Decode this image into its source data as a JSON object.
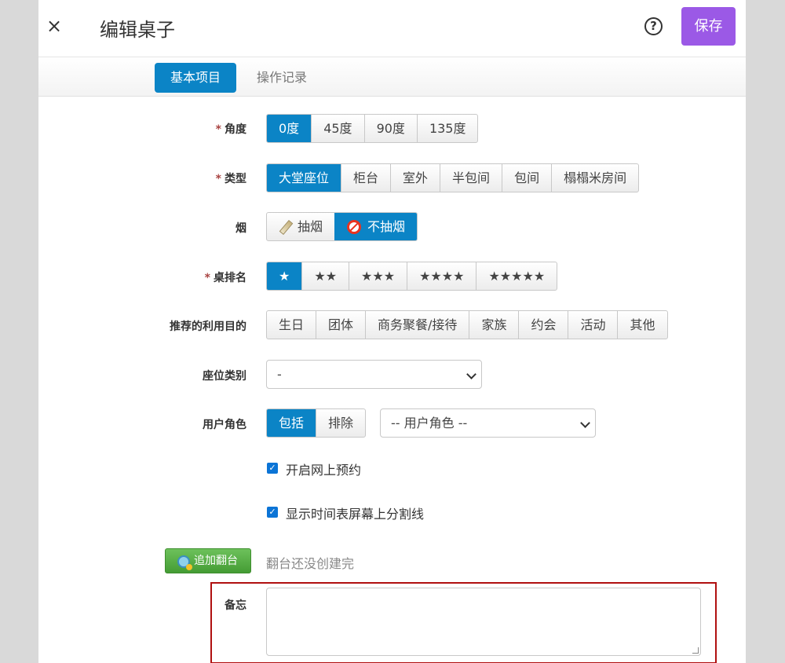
{
  "header": {
    "close_symbol": "×",
    "title": "编辑桌子",
    "help_symbol": "?",
    "save_label": "保存"
  },
  "tabs": [
    {
      "label": "基本项目",
      "active": true
    },
    {
      "label": "操作记录",
      "active": false
    }
  ],
  "required_mark": "*",
  "fields": {
    "angle": {
      "label": "角度",
      "options": [
        "0度",
        "45度",
        "90度",
        "135度"
      ],
      "selected": "0度"
    },
    "type": {
      "label": "类型",
      "options": [
        "大堂座位",
        "柜台",
        "室外",
        "半包间",
        "包间",
        "榻榻米房间"
      ],
      "selected": "大堂座位"
    },
    "smoke": {
      "label": "烟",
      "options": [
        "抽烟",
        "不抽烟"
      ],
      "selected": "不抽烟"
    },
    "rank": {
      "label": "桌排名",
      "options": [
        "★",
        "★★",
        "★★★",
        "★★★★",
        "★★★★★"
      ],
      "selected": "★"
    },
    "purpose": {
      "label": "推荐的利用目的",
      "options": [
        "生日",
        "团体",
        "商务聚餐/接待",
        "家族",
        "约会",
        "活动",
        "其他"
      ]
    },
    "seat_type": {
      "label": "座位类别",
      "value": "-"
    },
    "user_role": {
      "label": "用户角色",
      "options": [
        "包括",
        "排除"
      ],
      "selected": "包括",
      "select_value": "-- 用户角色 --"
    },
    "online_booking": {
      "label": "开启网上预约",
      "checked": true,
      "check_symbol": "✓"
    },
    "timeline_divider": {
      "label": "显示时间表屏幕上分割线",
      "checked": true,
      "check_symbol": "✓"
    },
    "turnover": {
      "button_label": "追加翻台",
      "note": "翻台还没创建完"
    },
    "memo": {
      "label": "备忘",
      "value": ""
    }
  },
  "colors": {
    "primary": "#0b84c6",
    "save": "#9b59e6",
    "green": "#449c34",
    "required": "#a94442",
    "highlight_border": "#b01010"
  }
}
